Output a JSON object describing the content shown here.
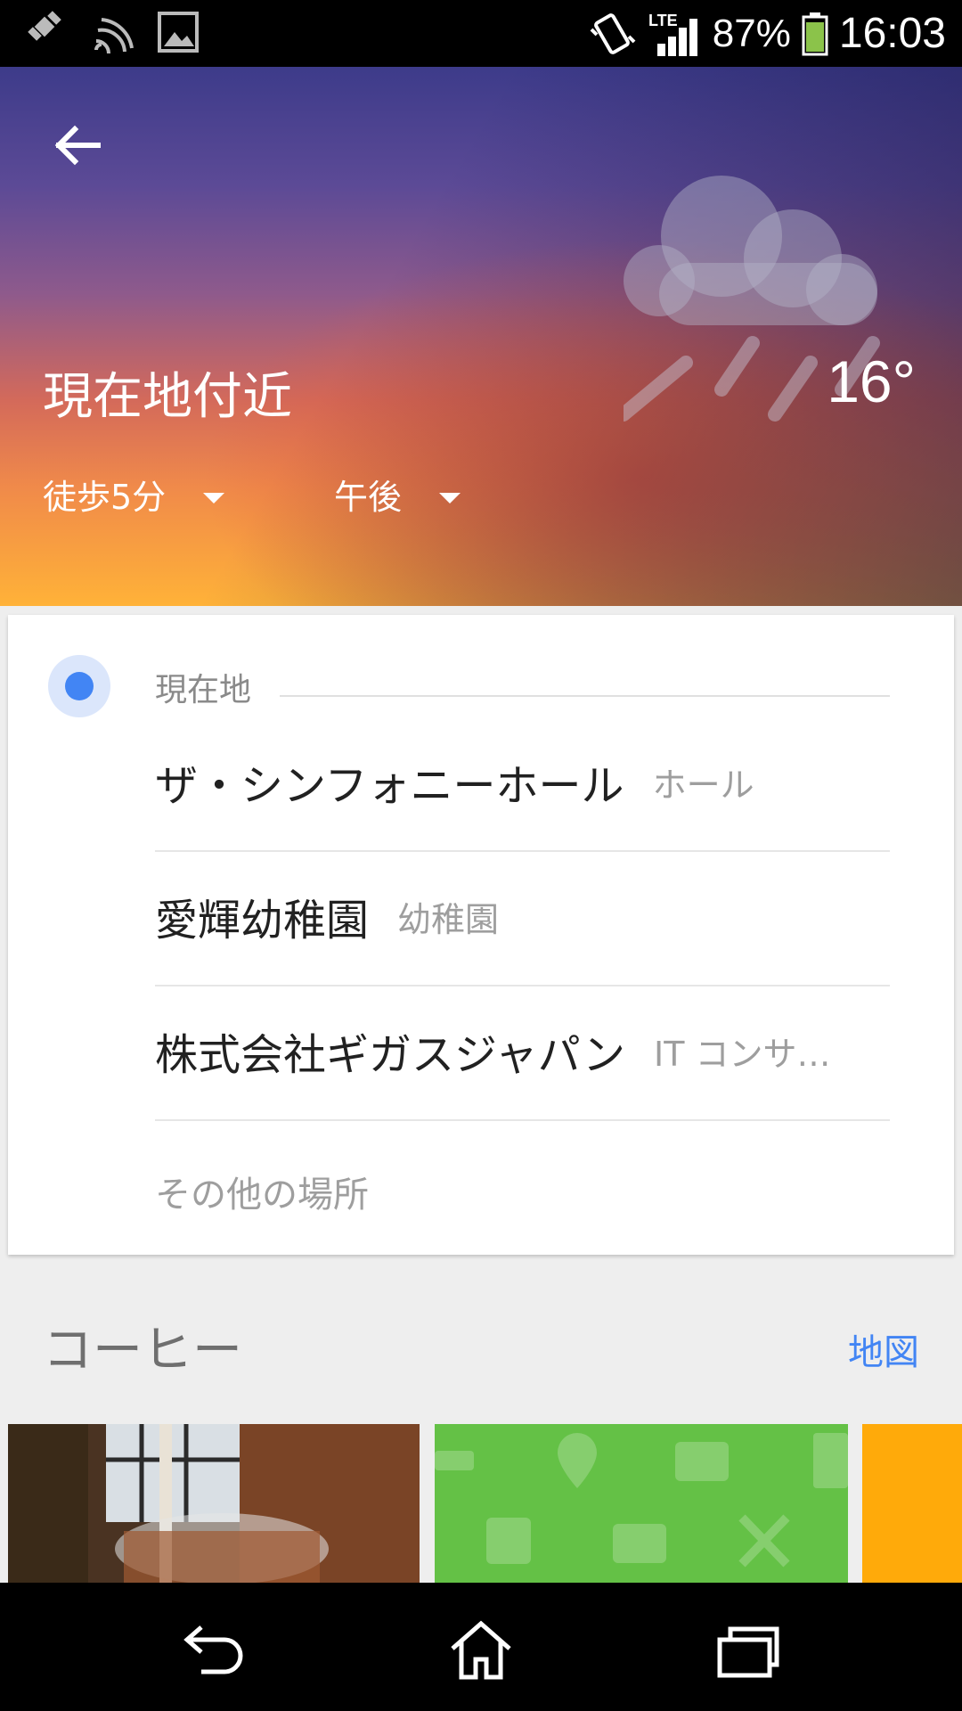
{
  "status_bar": {
    "battery": "87%",
    "network": "LTE",
    "time": "16:03"
  },
  "header": {
    "title": "現在地付近",
    "temperature": "16°",
    "weather": "rain-cloud-icon",
    "walk_dropdown": "徒歩5分",
    "time_dropdown": "午後"
  },
  "location_card": {
    "current_label": "現在地",
    "places": [
      {
        "name": "ザ・シンフォニーホール",
        "category": "ホール"
      },
      {
        "name": "愛輝幼稚園",
        "category": "幼稚園"
      },
      {
        "name": "株式会社ギガスジャパン",
        "category": "IT コンサ…"
      }
    ],
    "other_places": "その他の場所"
  },
  "coffee_section": {
    "title": "コーヒー",
    "map_link": "地図"
  },
  "colors": {
    "accent": "#4285f4",
    "tile_green": "#64c146",
    "tile_orange": "#ffaa0a"
  }
}
